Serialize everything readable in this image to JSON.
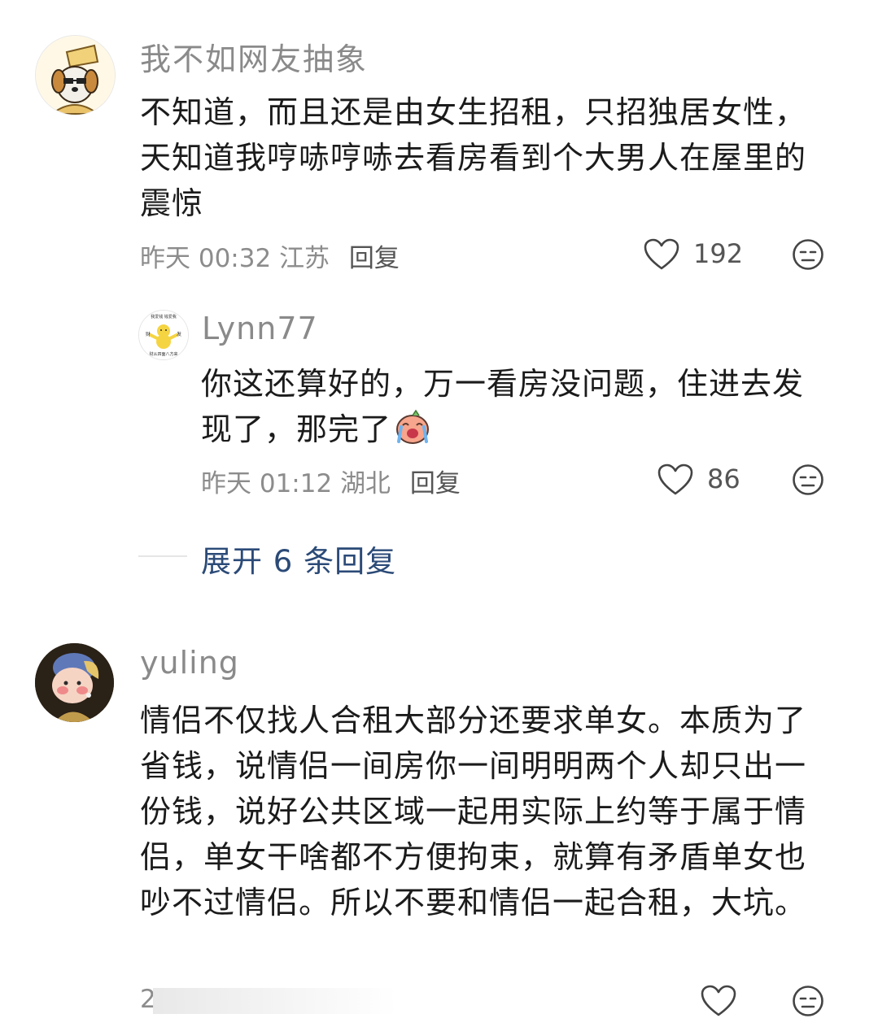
{
  "comments": [
    {
      "username": "我不如网友抽象",
      "text": "不知道，而且还是由女生招租，只招独居女性，天知道我哼哧哼哧去看房看到个大男人在屋里的震惊",
      "time": "昨天 00:32",
      "location": "江苏",
      "reply_label": "回复",
      "likes": "192",
      "avatar_icon": "dog-avatar"
    },
    {
      "username": "yuling",
      "text": "情侣不仅找人合租大部分还要求单女。本质为了省钱，说情侣一间房你一间明明两个人却只出一份钱，说好公共区域一起用实际上约等于属于情侣，单女干啥都不方便拘束，就算有矛盾单女也吵不过情侣。所以不要和情侣一起合租，大坑。",
      "time": "2",
      "avatar_icon": "girl-pearl-earring-avatar"
    }
  ],
  "reply": {
    "username": "Lynn77",
    "text": "你这还算好的，万一看房没问题，住进去发现了，那完了",
    "emoji": "crying-peach-emoji",
    "time": "昨天 01:12",
    "location": "湖北",
    "reply_label": "回复",
    "likes": "86",
    "avatar_text_top": "我爱钱 钱爱我",
    "avatar_text_left": "财",
    "avatar_text_right": "发",
    "avatar_text_bottom": "财从四面八方来",
    "avatar_icon": "yellow-figure-avatar"
  },
  "expand_replies": "展开 6 条回复",
  "colors": {
    "accent": "#2b4a77",
    "text": "#1b1b1b",
    "muted": "#8c8c8c"
  }
}
